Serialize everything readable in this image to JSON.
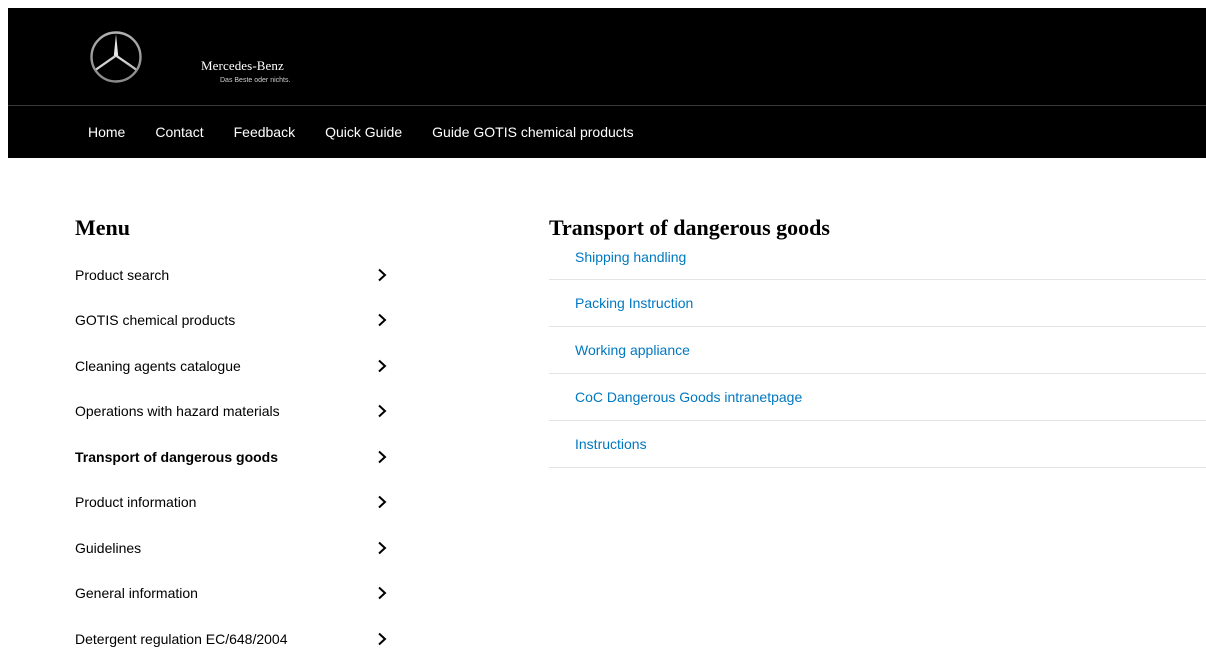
{
  "brand": {
    "name": "Mercedes-Benz",
    "slogan": "Das Beste oder nichts.",
    "logo_icon": "mercedes-star-icon"
  },
  "topnav": {
    "items": [
      {
        "label": "Home"
      },
      {
        "label": "Contact"
      },
      {
        "label": "Feedback"
      },
      {
        "label": "Quick Guide"
      },
      {
        "label": "Guide GOTIS chemical products"
      }
    ]
  },
  "menu": {
    "title": "Menu",
    "chevron_icon": "chevron-right-icon",
    "items": [
      {
        "label": "Product search",
        "active": false
      },
      {
        "label": "GOTIS chemical products",
        "active": false
      },
      {
        "label": "Cleaning agents catalogue",
        "active": false
      },
      {
        "label": "Operations with hazard materials",
        "active": false
      },
      {
        "label": "Transport of dangerous goods",
        "active": true
      },
      {
        "label": "Product information",
        "active": false
      },
      {
        "label": "Guidelines",
        "active": false
      },
      {
        "label": "General information",
        "active": false
      },
      {
        "label": "Detergent regulation EC/648/2004",
        "active": false
      }
    ]
  },
  "content": {
    "title": "Transport of dangerous goods",
    "link_color": "#0078c0",
    "links": [
      {
        "label": "Shipping handling"
      },
      {
        "label": "Packing Instruction"
      },
      {
        "label": "Working appliance"
      },
      {
        "label": "CoC Dangerous Goods intranetpage"
      },
      {
        "label": "Instructions"
      }
    ]
  }
}
